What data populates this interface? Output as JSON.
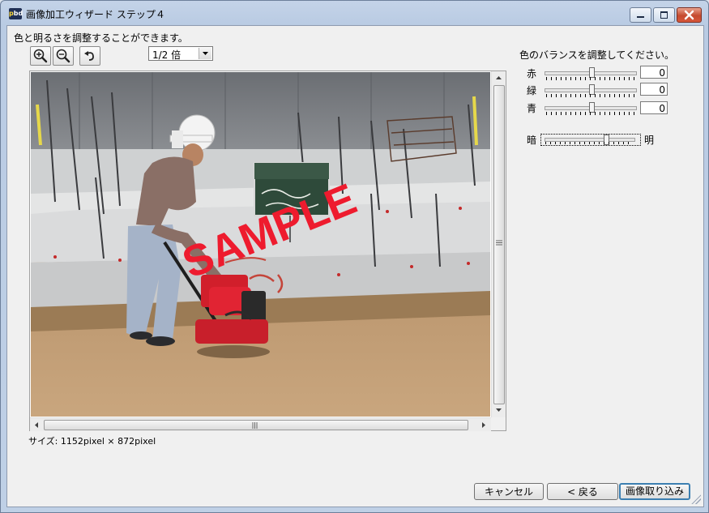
{
  "window": {
    "title": "画像加工ウィザード ステップ４",
    "app_icon_text": "pbd"
  },
  "instruction": "色と明るさを調整することができます。",
  "zoom": {
    "selected": "1/2 倍"
  },
  "image": {
    "watermark": "SAMPLE",
    "size_label": "サイズ: 1152pixel × 872pixel"
  },
  "balance": {
    "title": "色のバランスを調整してください。",
    "sliders": [
      {
        "label": "赤",
        "value": "0"
      },
      {
        "label": "緑",
        "value": "0"
      },
      {
        "label": "青",
        "value": "0"
      }
    ],
    "brightness": {
      "dark_label": "暗",
      "bright_label": "明"
    }
  },
  "buttons": {
    "cancel": "キャンセル",
    "back": "< 戻る",
    "import": "画像取り込み"
  },
  "icons": {
    "zoom_in": "zoom-in-icon",
    "zoom_out": "zoom-out-icon",
    "undo": "undo-icon"
  }
}
